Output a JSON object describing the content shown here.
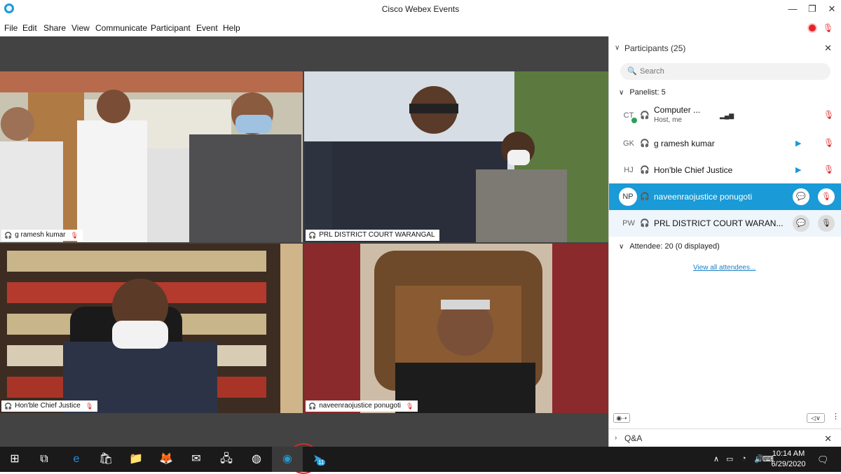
{
  "window": {
    "title": "Cisco Webex Events",
    "minimize": "—",
    "restore": "❐",
    "close": "✕"
  },
  "menu": [
    "File",
    "Edit",
    "Share",
    "View",
    "Communicate",
    "Participant",
    "Event",
    "Help"
  ],
  "tiles": [
    {
      "label": "g ramesh kumar",
      "active": false
    },
    {
      "label": "PRL DISTRICT COURT WARANGAL",
      "active": true
    },
    {
      "label": "Hon'ble Chief Justice",
      "active": false
    },
    {
      "label": "naveenraojustice ponugoti",
      "active": false
    }
  ],
  "panel": {
    "title": "Participants (25)",
    "search_placeholder": "Search",
    "panelist_header": "Panelist: 5",
    "attendee_header": "Attendee: 20 (0 displayed)",
    "view_all": "View all attendees...",
    "qa": "Q&A",
    "participants": [
      {
        "initials": "CT",
        "name": "Computer ...",
        "sub": "Host, me",
        "video": false
      },
      {
        "initials": "GK",
        "name": "g ramesh kumar",
        "video": true
      },
      {
        "initials": "HJ",
        "name": "Hon'ble Chief Justice",
        "video": true
      },
      {
        "initials": "NP",
        "name": "naveenraojustice ponugoti",
        "selected": true
      },
      {
        "initials": "PW",
        "name": "PRL DISTRICT COURT WARAN...",
        "hover": true
      }
    ]
  },
  "taskbar": {
    "time": "10:14 AM",
    "date": "6/29/2020",
    "badge": "11"
  },
  "icons": {
    "search": "search-icon",
    "headset": "headset-icon",
    "mic_muted": "mic-muted-icon",
    "video": "video-icon",
    "chat": "chat-icon"
  },
  "colors": {
    "accent": "#1a9ad6",
    "muted": "#d22222",
    "stage_bg": "#434343"
  }
}
